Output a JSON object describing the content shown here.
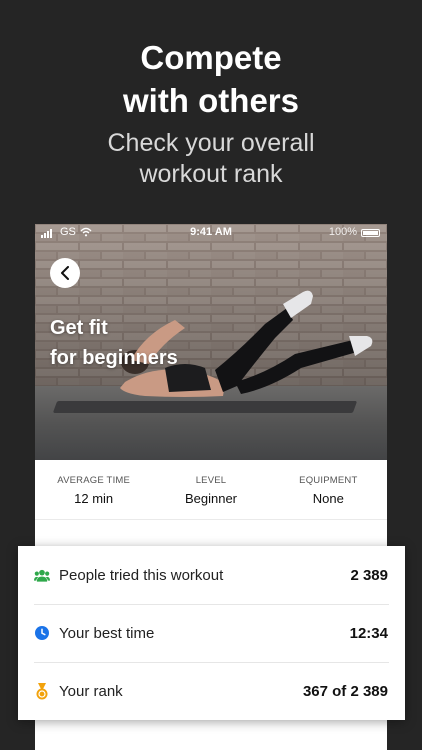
{
  "promo": {
    "title": "Compete\nwith others",
    "subtitle": "Check your overall\nworkout rank"
  },
  "status_bar": {
    "carrier": "GS",
    "time": "9:41 AM",
    "battery": "100%"
  },
  "workout": {
    "title": "Get fit\nfor beginners"
  },
  "stats": [
    {
      "label": "AVERAGE TIME",
      "value": "12 min"
    },
    {
      "label": "LEVEL",
      "value": "Beginner"
    },
    {
      "label": "EQUIPMENT",
      "value": "None"
    }
  ],
  "info": [
    {
      "icon": "people-icon",
      "label": "People tried this workout",
      "value": "2 389",
      "color": "#2ea84a"
    },
    {
      "icon": "clock-icon",
      "label": "Your best time",
      "value": "12:34",
      "color": "#1a73e8"
    },
    {
      "icon": "medal-icon",
      "label": "Your rank",
      "value": "367 of 2 389",
      "color": "#f2a20c"
    }
  ]
}
